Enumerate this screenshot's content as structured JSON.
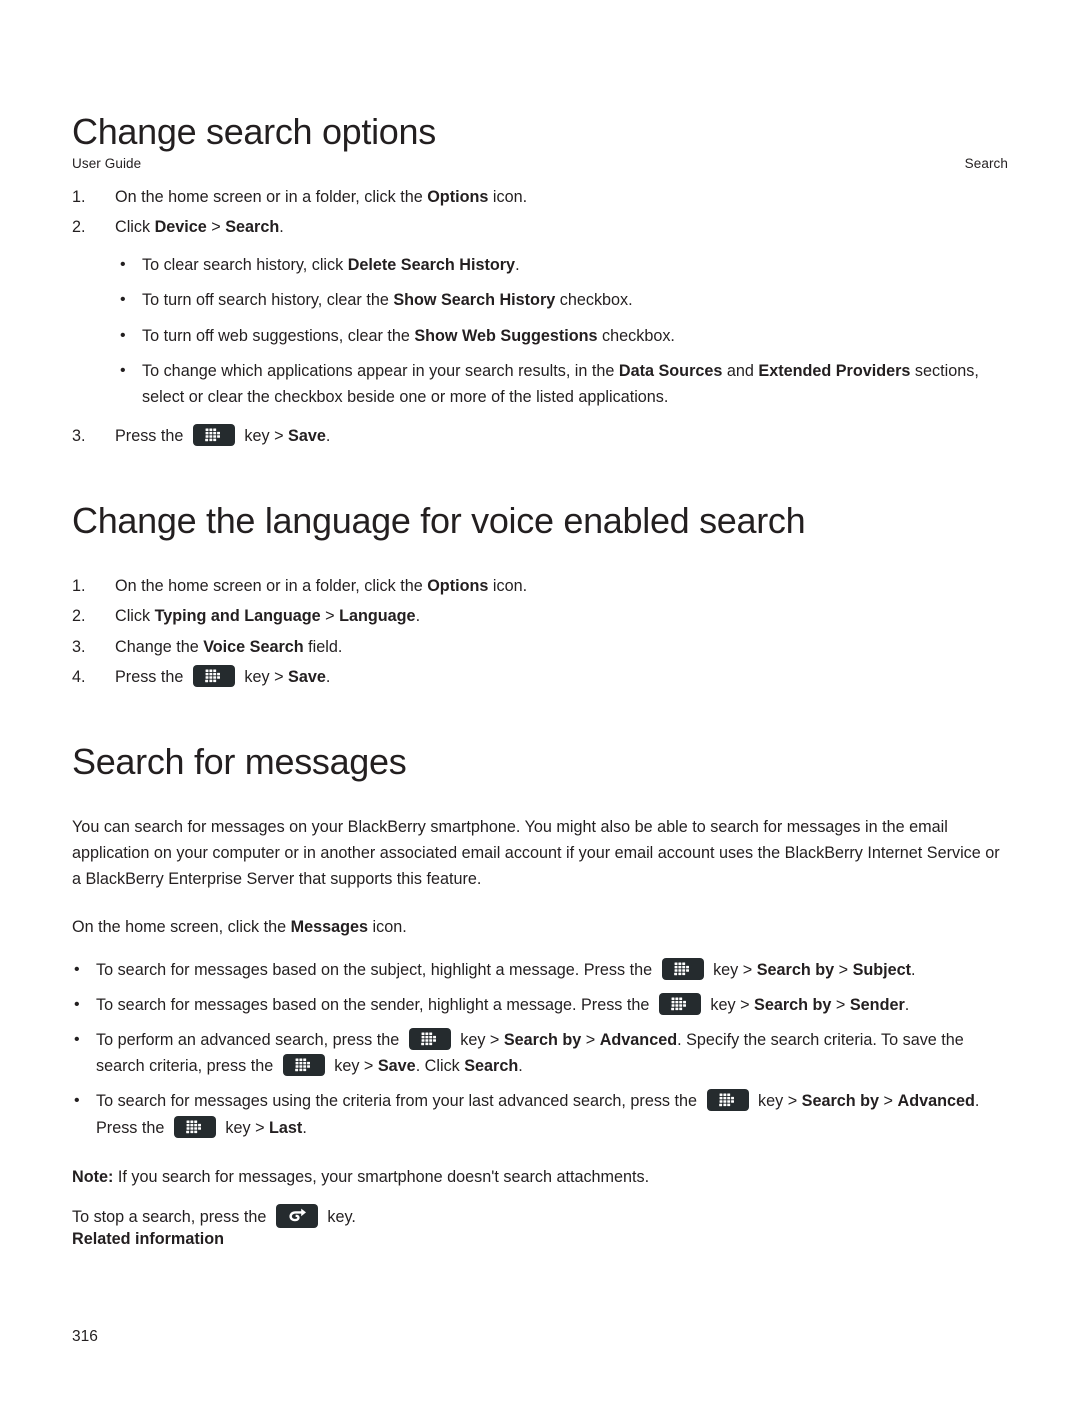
{
  "running_head": {
    "left": "User Guide",
    "right": "Search"
  },
  "sections": [
    {
      "id": "change-search-options",
      "title": "Change search options",
      "steps": [
        {
          "num": "1.",
          "parts": [
            {
              "t": "On the home screen or in a folder, click the "
            },
            {
              "t": "Options",
              "b": true
            },
            {
              "t": " icon."
            }
          ]
        },
        {
          "num": "2.",
          "parts": [
            {
              "t": "Click "
            },
            {
              "t": "Device",
              "b": true
            },
            {
              "t": " > "
            },
            {
              "t": "Search",
              "b": true
            },
            {
              "t": "."
            }
          ]
        }
      ],
      "sub_bullets": [
        [
          {
            "t": "To clear search history, click "
          },
          {
            "t": "Delete Search History",
            "b": true
          },
          {
            "t": "."
          }
        ],
        [
          {
            "t": "To turn off search history, clear the "
          },
          {
            "t": "Show Search History",
            "b": true
          },
          {
            "t": " checkbox."
          }
        ],
        [
          {
            "t": "To turn off web suggestions, clear the "
          },
          {
            "t": "Show Web Suggestions",
            "b": true
          },
          {
            "t": " checkbox."
          }
        ],
        [
          {
            "t": "To change which applications appear in your search results, in the "
          },
          {
            "t": "Data Sources",
            "b": true
          },
          {
            "t": " and "
          },
          {
            "t": "Extended Providers",
            "b": true
          },
          {
            "t": " sections, select or clear the checkbox beside one or more of the listed applications."
          }
        ]
      ],
      "final_step": {
        "num": "3.",
        "parts": [
          {
            "t": "Press the "
          },
          {
            "icon": "blackberry-menu-key"
          },
          {
            "t": " key > "
          },
          {
            "t": "Save",
            "b": true
          },
          {
            "t": "."
          }
        ]
      }
    },
    {
      "id": "change-language-voice-search",
      "title": "Change the language for voice enabled search",
      "steps": [
        {
          "num": "1.",
          "parts": [
            {
              "t": "On the home screen or in a folder, click the "
            },
            {
              "t": "Options",
              "b": true
            },
            {
              "t": " icon."
            }
          ]
        },
        {
          "num": "2.",
          "parts": [
            {
              "t": "Click "
            },
            {
              "t": "Typing and Language",
              "b": true
            },
            {
              "t": " > "
            },
            {
              "t": "Language",
              "b": true
            },
            {
              "t": "."
            }
          ]
        },
        {
          "num": "3.",
          "parts": [
            {
              "t": "Change the "
            },
            {
              "t": "Voice Search",
              "b": true
            },
            {
              "t": " field."
            }
          ]
        },
        {
          "num": "4.",
          "parts": [
            {
              "t": "Press the "
            },
            {
              "icon": "blackberry-menu-key"
            },
            {
              "t": " key > "
            },
            {
              "t": "Save",
              "b": true
            },
            {
              "t": "."
            }
          ]
        }
      ]
    },
    {
      "id": "search-for-messages",
      "title": "Search for messages",
      "intro": "You can search for messages on your BlackBerry smartphone. You might also be able to search for messages in the email application on your computer or in another associated email account if your email account uses the BlackBerry Internet Service or a BlackBerry Enterprise Server that supports this feature.",
      "lead_in": [
        {
          "t": "On the home screen, click the "
        },
        {
          "t": "Messages",
          "b": true
        },
        {
          "t": " icon."
        }
      ],
      "bullets": [
        [
          {
            "t": "To search for messages based on the subject, highlight a message. Press the "
          },
          {
            "icon": "blackberry-menu-key"
          },
          {
            "t": " key > "
          },
          {
            "t": "Search by",
            "b": true
          },
          {
            "t": " > "
          },
          {
            "t": "Subject",
            "b": true
          },
          {
            "t": "."
          }
        ],
        [
          {
            "t": "To search for messages based on the sender, highlight a message. Press the "
          },
          {
            "icon": "blackberry-menu-key"
          },
          {
            "t": " key > "
          },
          {
            "t": "Search by",
            "b": true
          },
          {
            "t": " > "
          },
          {
            "t": "Sender",
            "b": true
          },
          {
            "t": "."
          }
        ],
        [
          {
            "t": "To perform an advanced search, press the "
          },
          {
            "icon": "blackberry-menu-key"
          },
          {
            "t": " key > "
          },
          {
            "t": "Search by",
            "b": true
          },
          {
            "t": " > "
          },
          {
            "t": "Advanced",
            "b": true
          },
          {
            "t": ". Specify the search criteria. To save the search criteria, press the "
          },
          {
            "icon": "blackberry-menu-key"
          },
          {
            "t": " key > "
          },
          {
            "t": "Save",
            "b": true
          },
          {
            "t": ". Click "
          },
          {
            "t": "Search",
            "b": true
          },
          {
            "t": "."
          }
        ],
        [
          {
            "t": "To search for messages using the criteria from your last advanced search, press the "
          },
          {
            "icon": "blackberry-menu-key"
          },
          {
            "t": " key > "
          },
          {
            "t": "Search by",
            "b": true
          },
          {
            "t": " > "
          },
          {
            "t": "Advanced",
            "b": true
          },
          {
            "t": ". Press the "
          },
          {
            "icon": "blackberry-menu-key"
          },
          {
            "t": " key > "
          },
          {
            "t": "Last",
            "b": true
          },
          {
            "t": "."
          }
        ]
      ],
      "note": [
        {
          "t": "Note:",
          "b": true
        },
        {
          "t": " If you search for messages, your smartphone doesn't search attachments."
        }
      ],
      "stop_search": [
        {
          "t": "To stop a search, press the "
        },
        {
          "icon": "escape-key"
        },
        {
          "t": " key."
        }
      ],
      "related_information_label": "Related information"
    }
  ],
  "page_number": "316",
  "colors": {
    "text": "#231f20",
    "key_icon_background": "#252b2e",
    "key_icon_glyph": "#ffffff",
    "page_background": "#ffffff"
  }
}
